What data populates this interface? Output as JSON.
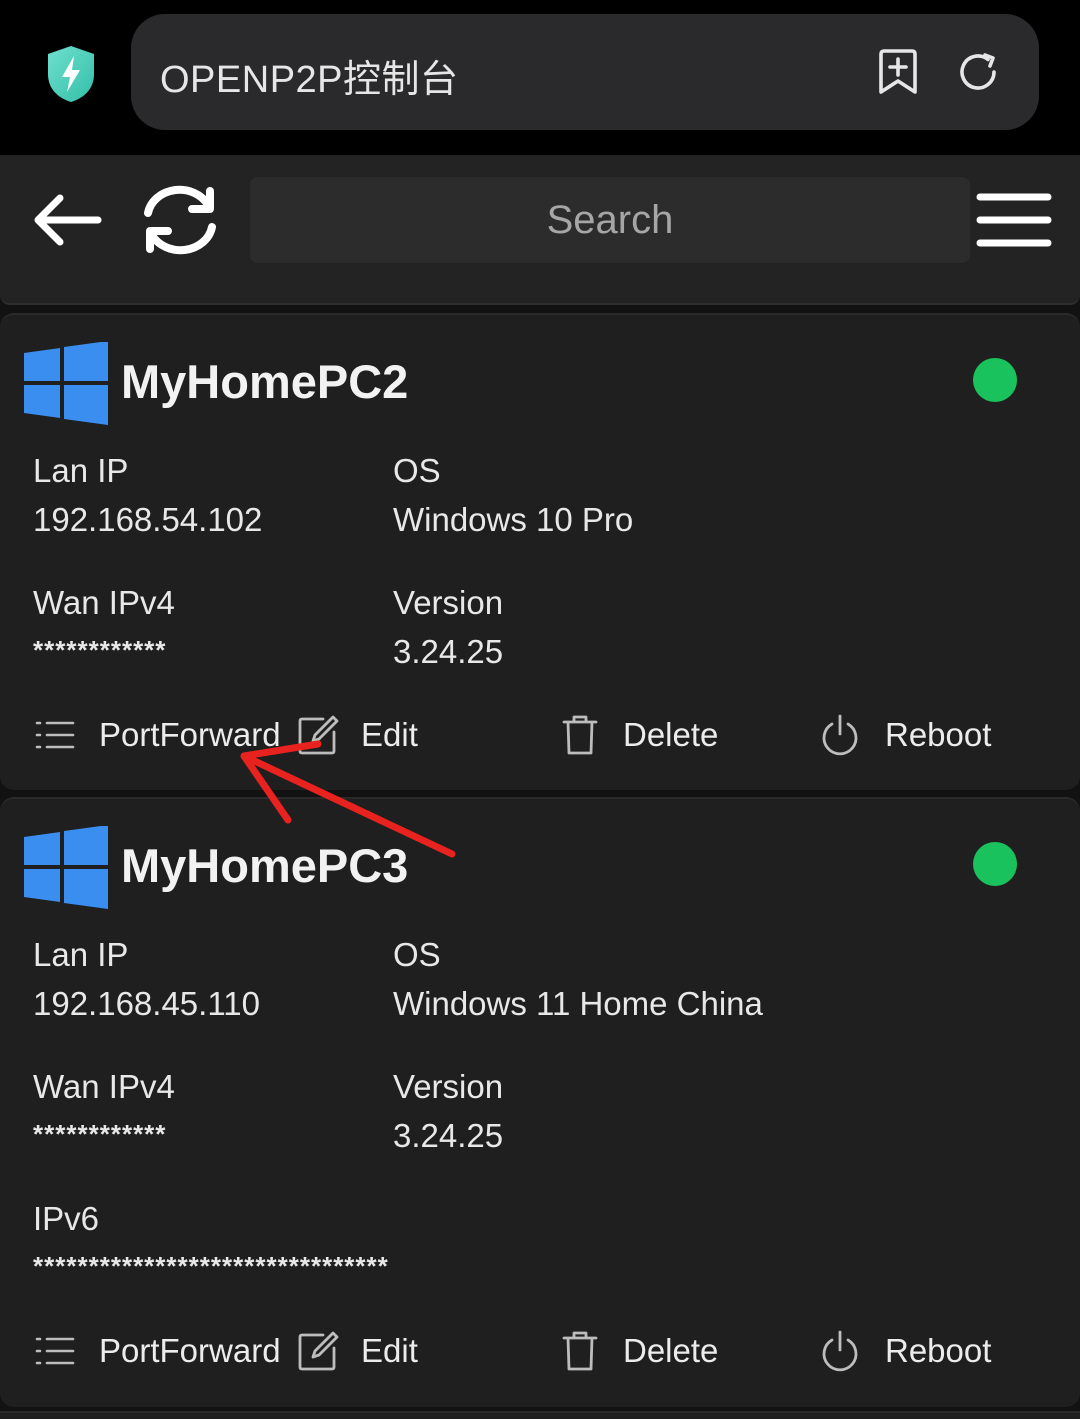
{
  "browser": {
    "url_title": "OPENP2P控制台",
    "icons": [
      "shield-bolt-icon",
      "bookmark-add-icon",
      "reload-icon"
    ]
  },
  "toolbar": {
    "search_placeholder": "Search",
    "icons": [
      "back-arrow-icon",
      "refresh-icon",
      "menu-icon"
    ]
  },
  "devices": [
    {
      "name": "MyHomePC2",
      "online": true,
      "lan_ip_label": "Lan IP",
      "lan_ip": "192.168.54.102",
      "os_label": "OS",
      "os": "Windows 10 Pro",
      "wan_label": "Wan IPv4",
      "wan": "************",
      "version_label": "Version",
      "version": "3.24.25",
      "actions": {
        "portforward": "PortForward",
        "edit": "Edit",
        "delete": "Delete",
        "reboot": "Reboot"
      }
    },
    {
      "name": "MyHomePC3",
      "online": true,
      "lan_ip_label": "Lan IP",
      "lan_ip": "192.168.45.110",
      "os_label": "OS",
      "os": "Windows 11 Home China",
      "wan_label": "Wan IPv4",
      "wan": "************",
      "version_label": "Version",
      "version": "3.24.25",
      "ipv6_label": "IPv6",
      "ipv6": "********************************",
      "actions": {
        "portforward": "PortForward",
        "edit": "Edit",
        "delete": "Delete",
        "reboot": "Reboot"
      }
    }
  ],
  "colors": {
    "online_dot": "#19c25c",
    "windows_logo": "#3a8ef0",
    "shield": "#4fd1c5",
    "annotation_arrow": "#e8231f"
  }
}
